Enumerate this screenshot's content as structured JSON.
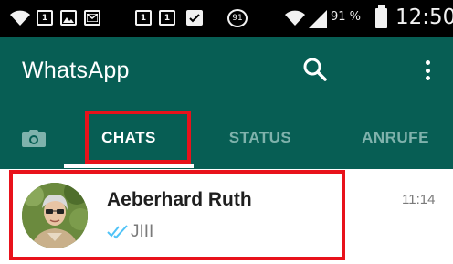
{
  "status_bar": {
    "notification_numbers": [
      "1",
      "1",
      "1"
    ],
    "circle_badge": "91",
    "battery_percent": "91 %",
    "time": "12:50"
  },
  "app_bar": {
    "title": "WhatsApp",
    "background_color": "#075e54",
    "icons": [
      "search-icon",
      "more-vertical-icon"
    ]
  },
  "tabs": [
    {
      "icon": "camera-icon"
    },
    {
      "label": "CHATS",
      "selected": true
    },
    {
      "label": "STATUS",
      "selected": false
    },
    {
      "label": "ANRUFE",
      "selected": false
    }
  ],
  "chats": [
    {
      "name": "Aeberhard Ruth",
      "time": "11:14",
      "message": "JIII",
      "status_icon": "double-check-read-icon",
      "tick_color": "#4fc3f7"
    }
  ],
  "highlight_color": "#e8121b"
}
